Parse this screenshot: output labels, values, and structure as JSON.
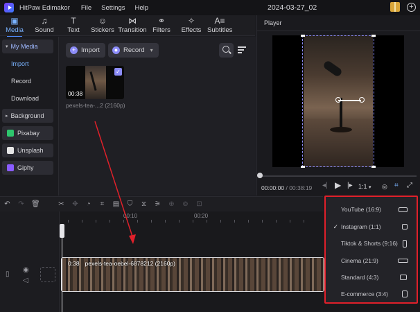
{
  "app": {
    "title": "HitPaw Edimakor",
    "menu": [
      "File",
      "Settings",
      "Help"
    ],
    "project_title": "2024-03-27_02"
  },
  "toolbar": {
    "tabs": [
      {
        "label": "Media",
        "icon": "media-icon",
        "active": true
      },
      {
        "label": "Sound",
        "icon": "music-note-icon",
        "active": false
      },
      {
        "label": "Text",
        "icon": "text-t-icon",
        "active": false
      },
      {
        "label": "Stickers",
        "icon": "smiley-icon",
        "active": false
      },
      {
        "label": "Transition",
        "icon": "bowtie-icon",
        "active": false
      },
      {
        "label": "Filters",
        "icon": "filter-circles-icon",
        "active": false
      },
      {
        "label": "Effects",
        "icon": "sparkle-icon",
        "active": false
      },
      {
        "label": "Subtitles",
        "icon": "subtitles-icon",
        "active": false
      }
    ]
  },
  "sidebar": {
    "my_media": "My Media",
    "sub_items": [
      "Import",
      "Record",
      "Download"
    ],
    "selected_sub": "Import",
    "background": "Background",
    "sources": [
      {
        "label": "Pixabay",
        "color": "#2ec66d"
      },
      {
        "label": "Unsplash",
        "color": "#ffffff"
      },
      {
        "label": "Giphy",
        "color": "#8a5cff"
      }
    ]
  },
  "media": {
    "import_label": "Import",
    "record_label": "Record",
    "clip": {
      "duration": "00:38",
      "name": "pexels-tea-...2 (2160p)",
      "checked": true
    }
  },
  "player": {
    "label": "Player",
    "current_time": "00:00:00",
    "total_time": "/ 00:38:19",
    "ratio": "1:1"
  },
  "timeline": {
    "ruler_labels": [
      "00:10",
      "00:20"
    ],
    "clip_duration": "0:38",
    "clip_name": "pexels-tea-oebel-6878212 (2160p)"
  },
  "ratio_menu": {
    "items": [
      {
        "label": "YouTube (16:9)",
        "checked": false
      },
      {
        "label": "Instagram (1:1)",
        "checked": true
      },
      {
        "label": "Tiktok & Shorts (9:16)",
        "checked": false
      },
      {
        "label": "Cinema (21:9)",
        "checked": false
      },
      {
        "label": "Standard (4:3)",
        "checked": false
      },
      {
        "label": "E-commerce (3:4)",
        "checked": false
      }
    ]
  },
  "colors": {
    "accent": "#7ab3ff",
    "highlight_box": "#e0202a",
    "arrow": "#e0202a",
    "selection": "#8c8cf8"
  }
}
